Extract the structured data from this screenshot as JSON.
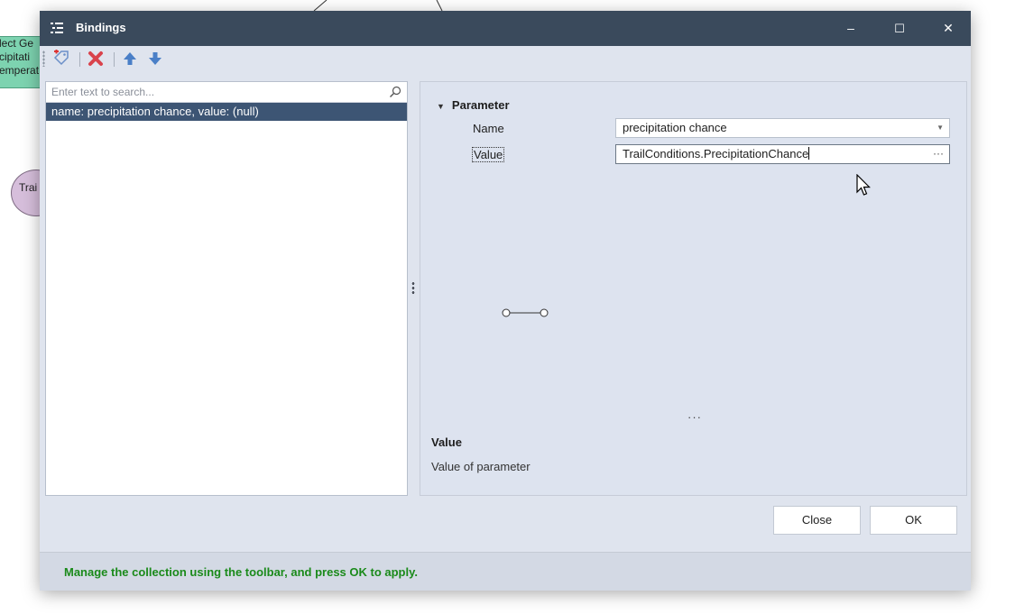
{
  "background": {
    "green_node_lines": [
      "lect Ge",
      "cipitati",
      "emperat"
    ],
    "oval_node_label": "Trai"
  },
  "dialog": {
    "title": "Bindings",
    "title_icon": "list-icon",
    "window_controls": {
      "minimize": "–",
      "maximize": "☐",
      "close": "✕"
    }
  },
  "toolbar": {
    "items": [
      {
        "name": "add-tag-icon"
      },
      {
        "name": "delete-icon"
      },
      {
        "name": "move-up-icon"
      },
      {
        "name": "move-down-icon"
      }
    ]
  },
  "list": {
    "search_placeholder": "Enter text to search...",
    "items": [
      {
        "label": "name: precipitation chance, value: (null)",
        "selected": true
      }
    ]
  },
  "properties": {
    "section_title": "Parameter",
    "name_label": "Name",
    "name_value": "precipitation chance",
    "value_label": "Value",
    "value_value": "TrailConditions.PrecipitationChance",
    "value_button": "···",
    "more": "···",
    "description_title": "Value",
    "description_text": "Value of parameter"
  },
  "buttons": {
    "close": "Close",
    "ok": "OK"
  },
  "status": {
    "text": "Manage the collection using the toolbar, and press OK to apply.",
    "color": "#1a8a1a"
  },
  "colors": {
    "titlebar": "#3a4a5c",
    "selection": "#3d5574",
    "dialog_bg": "#dfe4ee"
  }
}
